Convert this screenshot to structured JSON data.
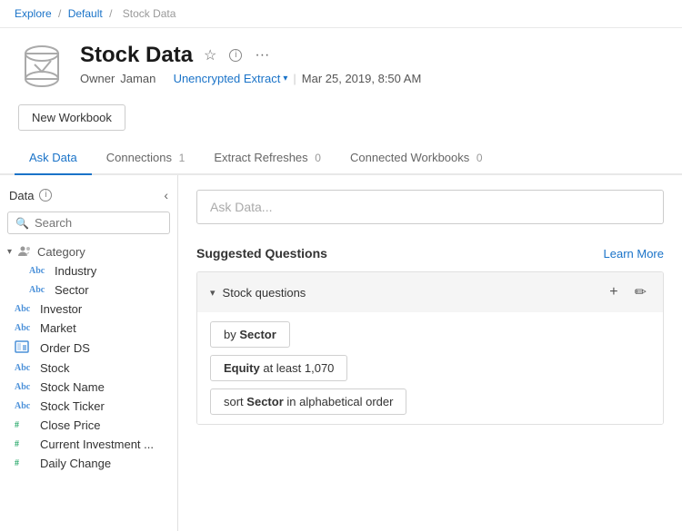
{
  "breadcrumb": {
    "explore": "Explore",
    "default": "Default",
    "current": "Stock Data",
    "sep": "/"
  },
  "header": {
    "title": "Stock Data",
    "owner_label": "Owner",
    "owner_name": "Jaman",
    "extract_label": "Unencrypted Extract",
    "date": "Mar 25, 2019, 8:50 AM",
    "star_icon": "★",
    "info_icon": "i",
    "more_icon": "···"
  },
  "toolbar": {
    "new_workbook_label": "New Workbook"
  },
  "tabs": [
    {
      "label": "Ask Data",
      "badge": "",
      "active": true
    },
    {
      "label": "Connections",
      "badge": "1",
      "active": false
    },
    {
      "label": "Extract Refreshes",
      "badge": "0",
      "active": false
    },
    {
      "label": "Connected Workbooks",
      "badge": "0",
      "active": false
    }
  ],
  "sidebar": {
    "title": "Data",
    "collapse_icon": "‹",
    "search_placeholder": "Search",
    "tree": [
      {
        "type": "category-header",
        "label": "Category",
        "icon": "people"
      },
      {
        "type": "abc",
        "label": "Industry",
        "indent": true
      },
      {
        "type": "abc",
        "label": "Sector",
        "indent": true
      },
      {
        "type": "abc",
        "label": "Investor"
      },
      {
        "type": "abc",
        "label": "Market"
      },
      {
        "type": "order",
        "label": "Order DS"
      },
      {
        "type": "abc",
        "label": "Stock"
      },
      {
        "type": "abc",
        "label": "Stock Name"
      },
      {
        "type": "abc",
        "label": "Stock Ticker"
      },
      {
        "type": "hash",
        "label": "Close Price"
      },
      {
        "type": "hash",
        "label": "Current Investment ..."
      },
      {
        "type": "hash",
        "label": "Daily Change"
      }
    ]
  },
  "right_panel": {
    "ask_data_placeholder": "Ask Data...",
    "suggested_questions_title": "Suggested Questions",
    "learn_more_label": "Learn More",
    "accordion_title": "Stock questions",
    "questions": [
      {
        "text": "by Sector",
        "bold_words": [
          "Sector"
        ]
      },
      {
        "text": "Equity at least 1,070",
        "bold_words": [
          "Equity"
        ]
      },
      {
        "text": "sort Sector in alphabetical order",
        "bold_words": [
          "Sector"
        ]
      }
    ]
  }
}
